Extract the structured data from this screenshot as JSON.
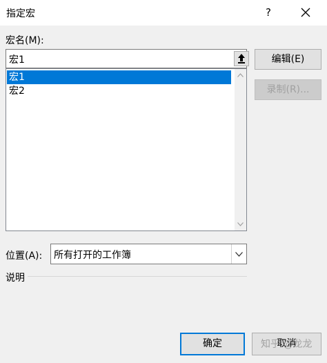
{
  "dialog": {
    "title": "指定宏",
    "help_label": "?",
    "macro_name_label": "宏名(M):",
    "macro_name_value": "宏1",
    "macros": [
      "宏1",
      "宏2"
    ],
    "selected_index": 0,
    "edit_label": "编辑(E)",
    "record_label": "录制(R)...",
    "location_label": "位置(A):",
    "location_value": "所有打开的工作簿",
    "description_label": "说明",
    "ok_label": "确定",
    "cancel_label": "取消"
  },
  "watermark": "知乎 @龙龙",
  "colors": {
    "selection": "#0078d7",
    "dialog_bg": "#f0f0f0",
    "disabled_text": "#a0a0a0"
  }
}
